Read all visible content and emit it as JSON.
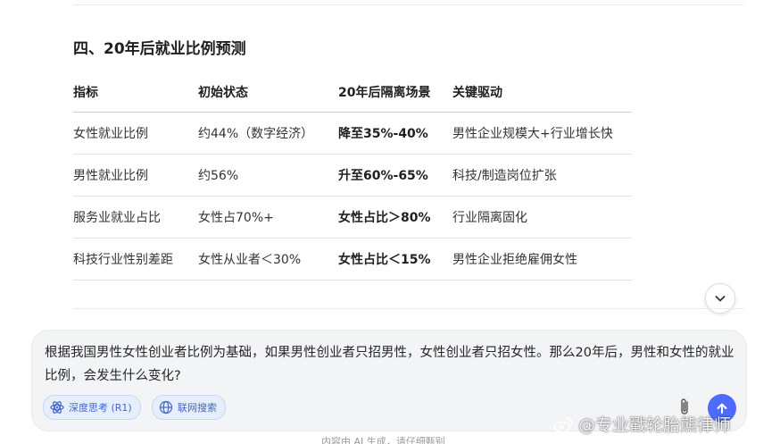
{
  "section": {
    "title": "四、20年后就业比例预测"
  },
  "table": {
    "headers": [
      "指标",
      "初始状态",
      "20年后隔离场景",
      "关键驱动"
    ],
    "rows": [
      [
        "女性就业比例",
        "约44%（数字经济）",
        "降至35%-40%",
        "男性企业规模大+行业增长快"
      ],
      [
        "男性就业比例",
        "约56%",
        "升至60%-65%",
        "科技/制造岗位扩张"
      ],
      [
        "服务业就业占比",
        "女性占70%+",
        "女性占比＞80%",
        "行业隔离固化"
      ],
      [
        "科技行业性别差距",
        "女性从业者＜30%",
        "女性占比＜15%",
        "男性企业拒绝雇佣女性"
      ]
    ]
  },
  "composer": {
    "prompt_text": "根据我国男性女性创业者比例为基础，如果男性创业者只招男性，女性创业者只招女性。那么20年后，男性和女性的就业比例，会发生什么变化?",
    "deep_think_label": "深度思考 (R1)",
    "web_search_label": "联网搜索"
  },
  "footer": {
    "note": "内容由 AI 生成，请仔细甄别"
  },
  "watermark": {
    "text": "@专业戳轮胎熊律师"
  },
  "icons": {
    "scroll": "chevron-down-icon",
    "deep_think": "atom-icon",
    "web_search": "globe-icon",
    "attach": "paperclip-icon",
    "send": "arrow-up-icon",
    "watermark": "weibo-icon"
  },
  "colors": {
    "accent": "#4d6bfe",
    "chip_bg": "#e6edfb",
    "chip_text": "#4466c8",
    "composer_bg": "#f3f4f6"
  }
}
